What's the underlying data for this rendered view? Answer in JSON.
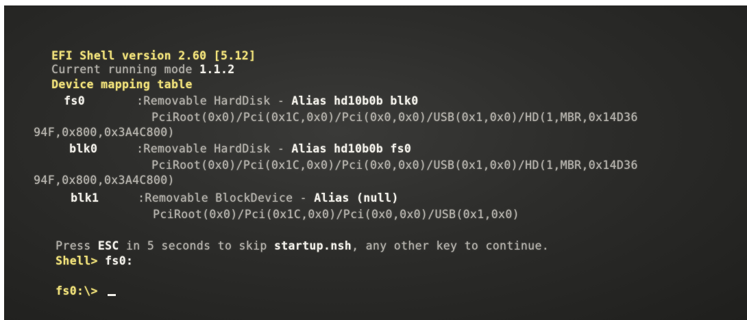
{
  "shell": {
    "version_line": "EFI Shell version 2.60 [5.12]",
    "mode_label": "Current running mode ",
    "mode_value": "1.1.2",
    "mapping_title": "Device mapping table"
  },
  "devices": [
    {
      "name": "fs0",
      "desc": ":Removable HardDisk - ",
      "alias": "Alias hd10b0b blk0",
      "path_line1": "PciRoot(0x0)/Pci(0x1C,0x0)/Pci(0x0,0x0)/USB(0x1,0x0)/HD(1,MBR,0x14D36",
      "path_line2": "94F,0x800,0x3A4C800)"
    },
    {
      "name": "blk0",
      "desc": ":Removable HardDisk - ",
      "alias": "Alias hd10b0b fs0",
      "path_line1": "PciRoot(0x0)/Pci(0x1C,0x0)/Pci(0x0,0x0)/USB(0x1,0x0)/HD(1,MBR,0x14D36",
      "path_line2": "94F,0x800,0x3A4C800)"
    },
    {
      "name": "blk1",
      "desc": ":Removable BlockDevice - ",
      "alias": "Alias (null)",
      "path_line1": "PciRoot(0x0)/Pci(0x1C,0x0)/Pci(0x0,0x0)/USB(0x1,0x0)"
    }
  ],
  "startup": {
    "press": "Press ",
    "esc": "ESC",
    "middle": " in 5 seconds to skip ",
    "script": "startup.nsh",
    "end": ", any other key to continue."
  },
  "prompt1": {
    "prompt": "Shell> ",
    "command": "fs0:"
  },
  "prompt2": {
    "prompt": "fs0:\\> "
  },
  "colors": {
    "screen_bg": "#2c2c2a",
    "text": "#c9c6c0",
    "highlight_yellow": "#efe07a",
    "highlight_white": "#f2f0ea"
  }
}
